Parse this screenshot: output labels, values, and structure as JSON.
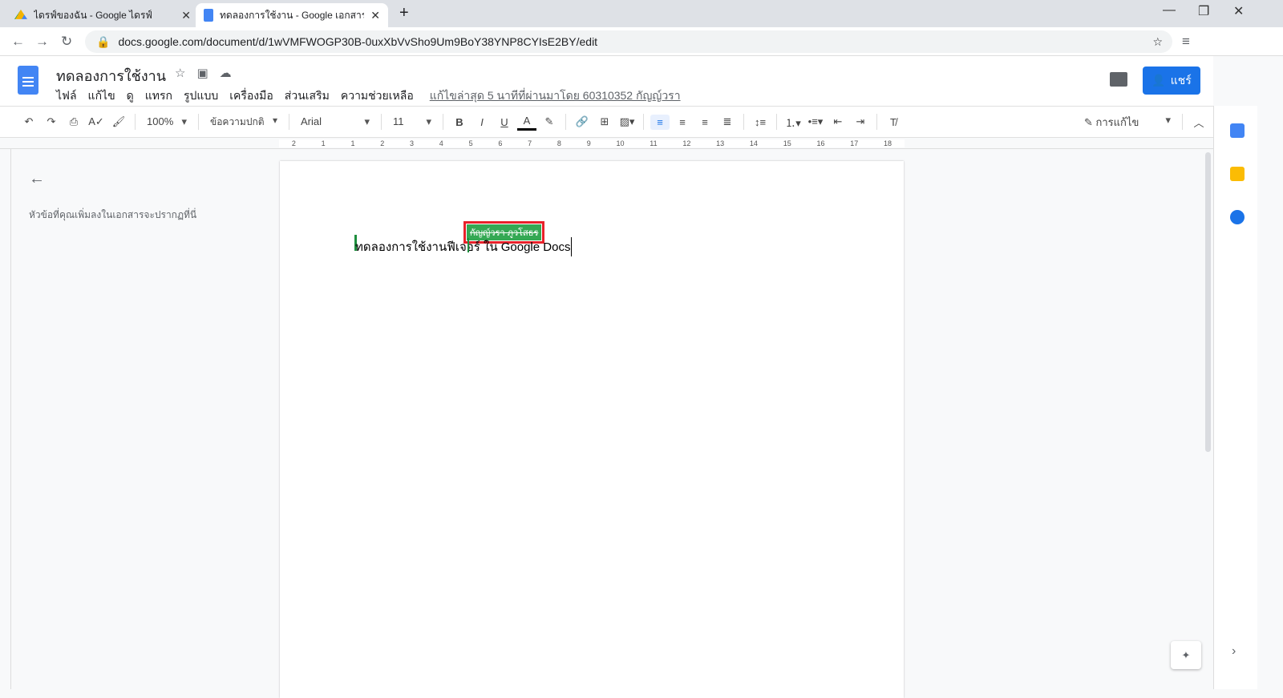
{
  "browser": {
    "tabs": [
      {
        "title": "ไดรฟ์ของฉัน - Google ไดรฟ์",
        "active": false
      },
      {
        "title": "ทดลองการใช้งาน - Google เอกสาร",
        "active": true
      }
    ],
    "url": "docs.google.com/document/d/1wVMFWOGP30B-0uxXbVvSho9Um9BoY38YNP8CYIsE2BY/edit"
  },
  "doc": {
    "title": "ทดลองการใช้งาน",
    "menu": [
      "ไฟล์",
      "แก้ไข",
      "ดู",
      "แทรก",
      "รูปแบบ",
      "เครื่องมือ",
      "ส่วนเสริม",
      "ความช่วยเหลือ"
    ],
    "last_edit": "แก้ไขล่าสุด 5 นาทีที่ผ่านมาโดย 60310352 กัญญ์วรา",
    "share": "แชร์"
  },
  "toolbar": {
    "zoom": "100%",
    "style": "ข้อความปกติ",
    "font": "Arial",
    "size": "11",
    "mode": "การแก้ไข"
  },
  "ruler": [
    "2",
    "1",
    "1",
    "2",
    "3",
    "4",
    "5",
    "6",
    "7",
    "8",
    "9",
    "10",
    "11",
    "12",
    "13",
    "14",
    "15",
    "16",
    "17",
    "18"
  ],
  "outline": {
    "hint": "หัวข้อที่คุณเพิ่มลงในเอกสารจะปรากฏที่นี่"
  },
  "body": {
    "text": "ทดลองการใช้งานฟีเจอร์ ใน Google Docs",
    "collaborator": "กัญญ์วรา ภูวโสธร"
  },
  "colors": {
    "accent": "#1a73e8",
    "collab": "#34a853",
    "highlight": "#e8212a"
  }
}
